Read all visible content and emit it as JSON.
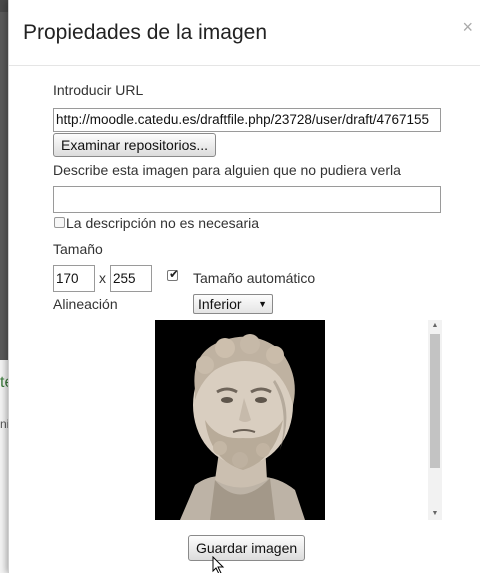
{
  "dialog": {
    "title": "Propiedades de la imagen",
    "close_label": "×"
  },
  "url": {
    "label": "Introducir URL",
    "value": "http://moodle.catedu.es/draftfile.php/23728/user/draft/4767155"
  },
  "browse_button": "Examinar repositorios...",
  "description": {
    "label": "Describe esta imagen para alguien que no pudiera verla",
    "value": "",
    "not_needed_label": "La descripción no es necesaria",
    "not_needed_checked": false
  },
  "size": {
    "label": "Tamaño",
    "width": "170",
    "separator": "x",
    "height": "255",
    "auto_label": "Tamaño automático",
    "auto_checked": true
  },
  "alignment": {
    "label": "Alineación",
    "selected": "Inferior"
  },
  "preview": {
    "image_subject": "marble-bust-image"
  },
  "save_button": "Guardar imagen",
  "background": {
    "partial_letter_1": "te",
    "partial_letter_2": "ni"
  }
}
